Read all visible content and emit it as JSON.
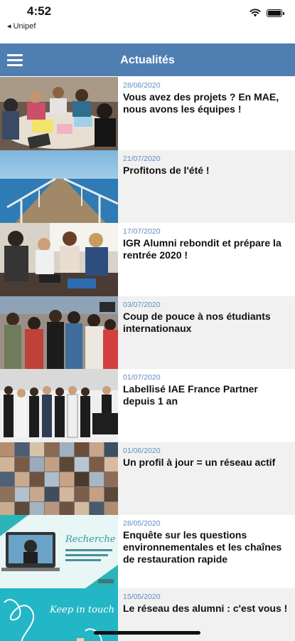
{
  "status": {
    "time": "4:52",
    "back_app": "◂ Unipef"
  },
  "header": {
    "title": "Actualités"
  },
  "news": [
    {
      "date": "28/08/2020",
      "title": "Vous avez des projets ? En MAE, nous avons les équipes !"
    },
    {
      "date": "21/07/2020",
      "title": "Profitons de l'été !"
    },
    {
      "date": "17/07/2020",
      "title": "IGR Alumni rebondit et prépare la rentrée 2020 !"
    },
    {
      "date": "03/07/2020",
      "title": "Coup de pouce à nos étudiants internationaux"
    },
    {
      "date": "01/07/2020",
      "title": "Labellisé IAE France Partner depuis 1 an"
    },
    {
      "date": "01/06/2020",
      "title": "Un profil à jour = un réseau actif"
    },
    {
      "date": "28/05/2020",
      "title": "Enquête sur les questions environnementales et les chaînes de restauration rapide"
    },
    {
      "date": "15/05/2020",
      "title": "Le réseau des alumni : c'est vous !"
    }
  ],
  "thumb_text": {
    "recherche": "Recherche",
    "keep": "Keep in touch"
  }
}
